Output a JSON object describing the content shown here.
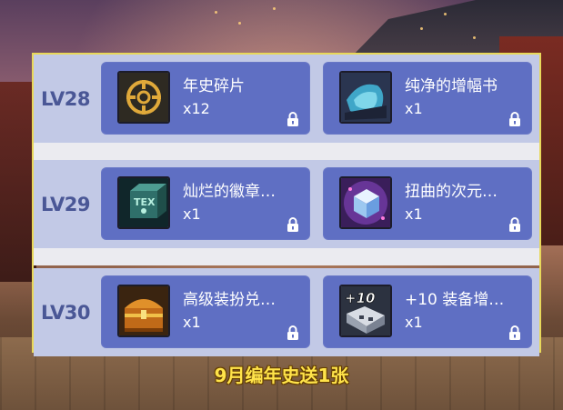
{
  "rows": [
    {
      "level": "LV28",
      "items": [
        {
          "name": "年史碎片",
          "qty": "x12",
          "icon": "gold-coin-icon",
          "locked": true
        },
        {
          "name": "纯净的增幅书",
          "qty": "x1",
          "icon": "blue-book-icon",
          "locked": true
        }
      ]
    },
    {
      "level": "LV29",
      "items": [
        {
          "name": "灿烂的徽章…",
          "qty": "x1",
          "icon": "emblem-box-icon",
          "locked": true
        },
        {
          "name": "扭曲的次元…",
          "qty": "x1",
          "icon": "cube-icon",
          "locked": true
        }
      ]
    },
    {
      "level": "LV30",
      "items": [
        {
          "name": "高级装扮兑…",
          "qty": "x1",
          "icon": "treasure-chest-icon",
          "locked": true
        },
        {
          "name": "+10 装备增…",
          "qty": "x1",
          "icon": "plus10-upgrade-icon",
          "icon_text": "+10",
          "locked": true
        }
      ]
    }
  ],
  "caption": "9月编年史送1张",
  "colors": {
    "card": "#5f6fc3",
    "row": "#c2c9e6",
    "level_text": "#4a5796",
    "caption": "#ffe34a",
    "panel_border": "#e8d85a"
  }
}
